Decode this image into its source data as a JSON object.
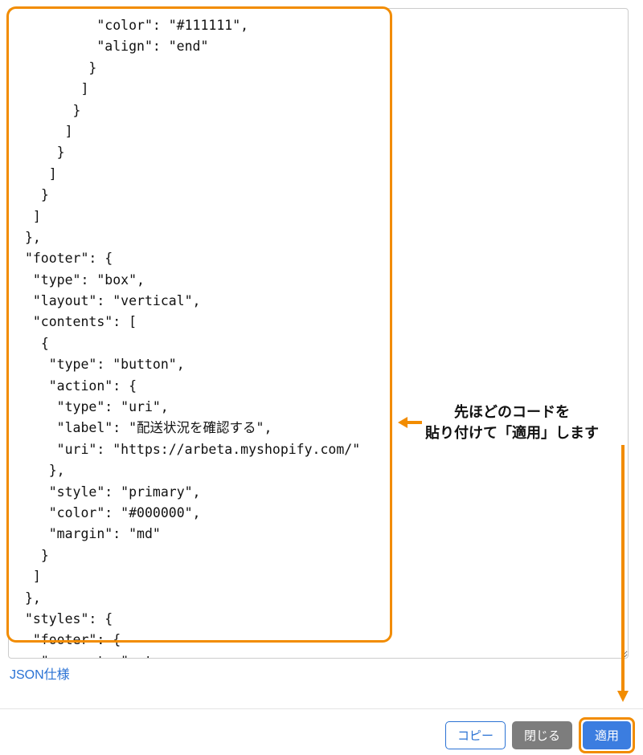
{
  "code_content": "          \"color\": \"#111111\",\n          \"align\": \"end\"\n         }\n        ]\n       }\n      ]\n     }\n    ]\n   }\n  ]\n },\n \"footer\": {\n  \"type\": \"box\",\n  \"layout\": \"vertical\",\n  \"contents\": [\n   {\n    \"type\": \"button\",\n    \"action\": {\n     \"type\": \"uri\",\n     \"label\": \"配送状況を確認する\",\n     \"uri\": \"https://arbeta.myshopify.com/\"\n    },\n    \"style\": \"primary\",\n    \"color\": \"#000000\",\n    \"margin\": \"md\"\n   }\n  ]\n },\n \"styles\": {\n  \"footer\": {\n   \"separator\": true\n  }\n }\n}",
  "json_spec_link": "JSON仕様",
  "annotation": {
    "line1": "先ほどのコードを",
    "line2": "貼り付けて「適用」します"
  },
  "buttons": {
    "copy": "コピー",
    "close": "閉じる",
    "apply": "適用"
  },
  "colors": {
    "highlight": "#f28c00",
    "link": "#2a72d4",
    "primary": "#3b7de0",
    "grey": "#7d7d7d"
  }
}
